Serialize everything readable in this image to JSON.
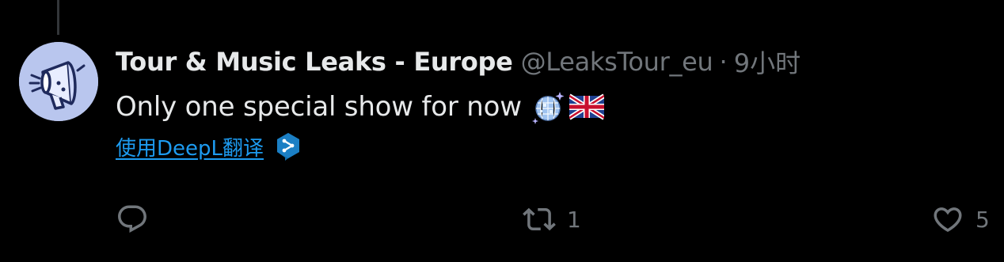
{
  "tweet": {
    "author": {
      "display_name": "Tour & Music Leaks - Europe",
      "handle": "@LeaksTour_eu",
      "separator": "·",
      "timestamp": "9小时"
    },
    "text": "Only one special show for now",
    "emojis": [
      "disco-ball",
      "flag-united-kingdom"
    ],
    "translate_label": "使用DeepL翻译",
    "actions": {
      "reply": {
        "icon": "reply-icon",
        "count": ""
      },
      "retweet": {
        "icon": "retweet-icon",
        "count": "1"
      },
      "like": {
        "icon": "heart-icon",
        "count": "5"
      }
    }
  },
  "colors": {
    "background": "#000000",
    "primary_text": "#e7e9ea",
    "secondary_text": "#71767b",
    "link": "#1d9bf0",
    "deepl_badge": "#0f6ba8",
    "avatar_bg": "#b9c6ee"
  }
}
